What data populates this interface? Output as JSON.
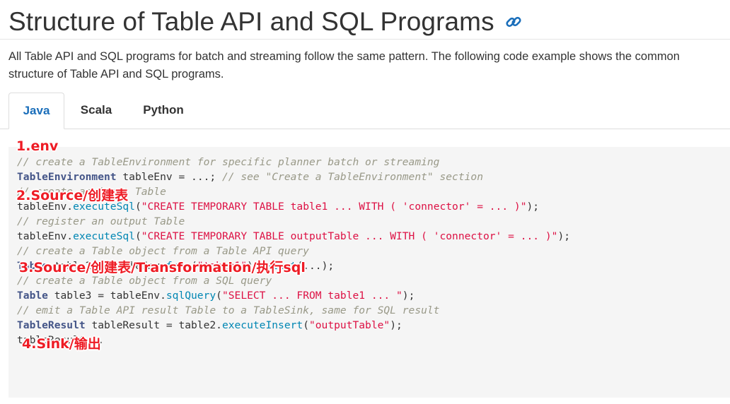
{
  "header": {
    "title": "Structure of Table API and SQL Programs",
    "anchor_icon": "link-icon"
  },
  "intro": "All Table API and SQL programs for batch and streaming follow the same pattern. The following code example shows the common structure of Table API and SQL programs.",
  "tabs": [
    {
      "label": "Java",
      "active": true
    },
    {
      "label": "Scala",
      "active": false
    },
    {
      "label": "Python",
      "active": false
    }
  ],
  "annotations": {
    "env": "1.env",
    "source": "2.Source/创建表",
    "transformation": "3.Source/创建表/Transformation/执行sql",
    "sink": "4.Sink/输出"
  },
  "code": {
    "l1": "// create a TableEnvironment for specific planner batch or streaming",
    "l2": {
      "t1": "TableEnvironment",
      "t2": " tableEnv = ...; ",
      "t3": "// see \"Create a TableEnvironment\" section"
    },
    "l3": "// create an input Table",
    "l4": {
      "t1": "tableEnv.",
      "t2": "executeSql",
      "t3": "(",
      "t4": "\"CREATE TEMPORARY TABLE table1 ... WITH ( 'connector' = ... )\"",
      "t5": ");"
    },
    "l5": "// register an output Table",
    "l6": {
      "t1": "tableEnv.",
      "t2": "executeSql",
      "t3": "(",
      "t4": "\"CREATE TEMPORARY TABLE outputTable ... WITH ( 'connector' = ... )\"",
      "t5": ");"
    },
    "l7": "// create a Table object from a Table API query",
    "l8": {
      "t1": "Table",
      "t2": " table2 = tableEnv.",
      "t3": "from",
      "t4": "(",
      "t5": "\"table1\"",
      "t6": ").",
      "t7": "select",
      "t8": "(...);"
    },
    "l9": "// create a Table object from a SQL query",
    "l10": {
      "t1": "Table",
      "t2": " table3 = tableEnv.",
      "t3": "sqlQuery",
      "t4": "(",
      "t5": "\"SELECT ... FROM table1 ... \"",
      "t6": ");"
    },
    "l11": "// emit a Table API result Table to a TableSink, same for SQL result",
    "l12": {
      "t1": "TableResult",
      "t2": " tableResult = table2.",
      "t3": "executeInsert",
      "t4": "(",
      "t5": "\"outputTable\"",
      "t6": ");"
    },
    "l13": "tableResult..."
  }
}
